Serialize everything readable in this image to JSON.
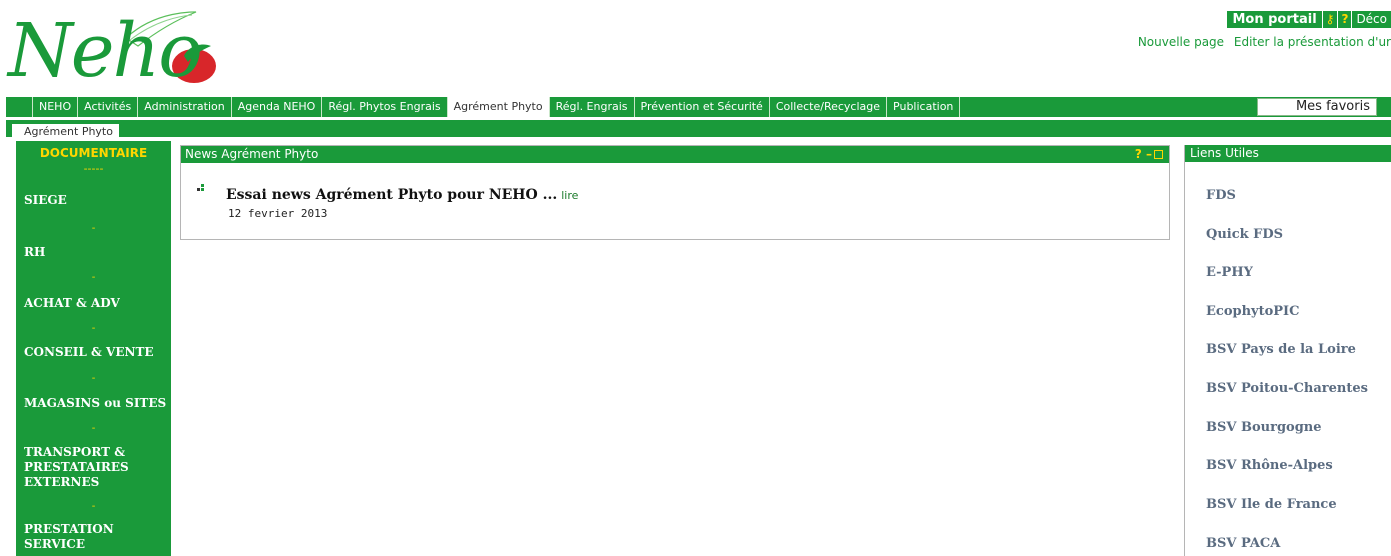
{
  "logo": {
    "text": "Neho"
  },
  "top_right": {
    "portal_label": "Mon portail",
    "tool_icons": [
      "wrench-icon",
      "help-icon"
    ],
    "tool_glyphs": [
      "⚷",
      "?"
    ],
    "logout_label": "Déco",
    "links": [
      "Nouvelle page",
      "Editer la présentation d'ur"
    ]
  },
  "nav": {
    "tabs": [
      "NEHO",
      "Activités",
      "Administration",
      "Agenda NEHO",
      "Régl. Phytos Engrais",
      "Agrément Phyto",
      "Régl. Engrais",
      "Prévention et Sécurité",
      "Collecte/Recyclage",
      "Publication"
    ],
    "active_tab": "Agrément Phyto",
    "favorites": "Mes favoris"
  },
  "breadcrumb": "Agrément Phyto",
  "left_menu": {
    "title": "DOCUMENTAIRE",
    "title_dashes": "-----",
    "items": [
      "SIEGE",
      "RH",
      "ACHAT & ADV",
      "CONSEIL & VENTE",
      "MAGASINS ou SITES",
      "TRANSPORT & PRESTATAIRES EXTERNES",
      "PRESTATION SERVICE"
    ],
    "separator": "-"
  },
  "news": {
    "header": "News Agrément Phyto",
    "controls": "? –",
    "entry": {
      "title": "Essai news Agrément Phyto pour NEHO ...",
      "more": "lire",
      "date": "12 fevrier 2013"
    }
  },
  "links": {
    "header": "Liens Utiles",
    "items": [
      "FDS",
      "Quick FDS",
      "E-PHY",
      "EcophytoPIC",
      "BSV Pays de la Loire",
      "BSV Poitou-Charentes",
      "BSV Bourgogne",
      "BSV Rhône-Alpes",
      "BSV Ile de France",
      "BSV PACA"
    ]
  },
  "colors": {
    "brand_green": "#1a9a3a",
    "accent_yellow": "#ffd600",
    "link_grey_blue": "#5a6b80"
  }
}
